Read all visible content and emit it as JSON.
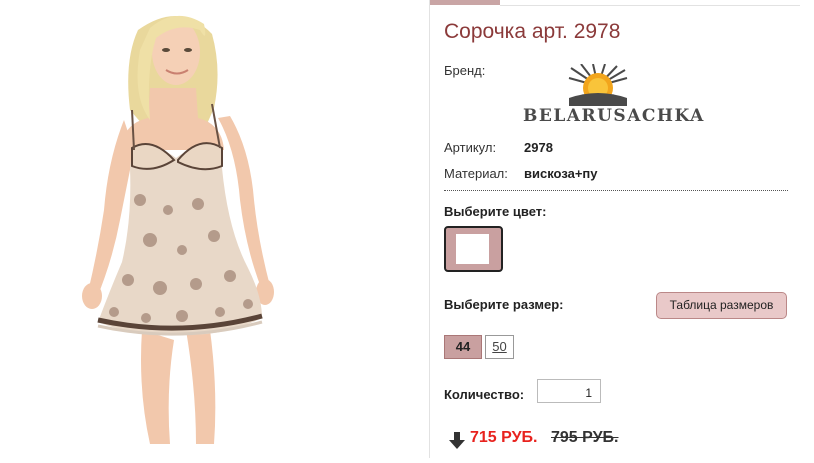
{
  "product": {
    "title": "Сорочка арт. 2978",
    "brand_label": "Бренд:",
    "brand_logo_text": "BELARUSACHKA",
    "article_label": "Артикул:",
    "article_value": "2978",
    "material_label": "Материал:",
    "material_value": "вискоза+пу"
  },
  "color_section": {
    "label": "Выберите цвет:",
    "swatch_color": "#c9a0a0"
  },
  "size_section": {
    "label": "Выберите размер:",
    "size_table_button": "Таблица размеров",
    "sizes": [
      "44",
      "50"
    ],
    "selected": "44"
  },
  "quantity": {
    "label": "Количество:",
    "value": "1"
  },
  "price": {
    "new": "715 РУБ.",
    "old": "795 РУБ.",
    "new_color": "#e8221e"
  },
  "colors": {
    "title": "#8b3a3a",
    "accent": "#c9a0a0"
  },
  "icons": {
    "logo": "sun-logo-icon",
    "price_arrow": "arrow-down-icon"
  }
}
